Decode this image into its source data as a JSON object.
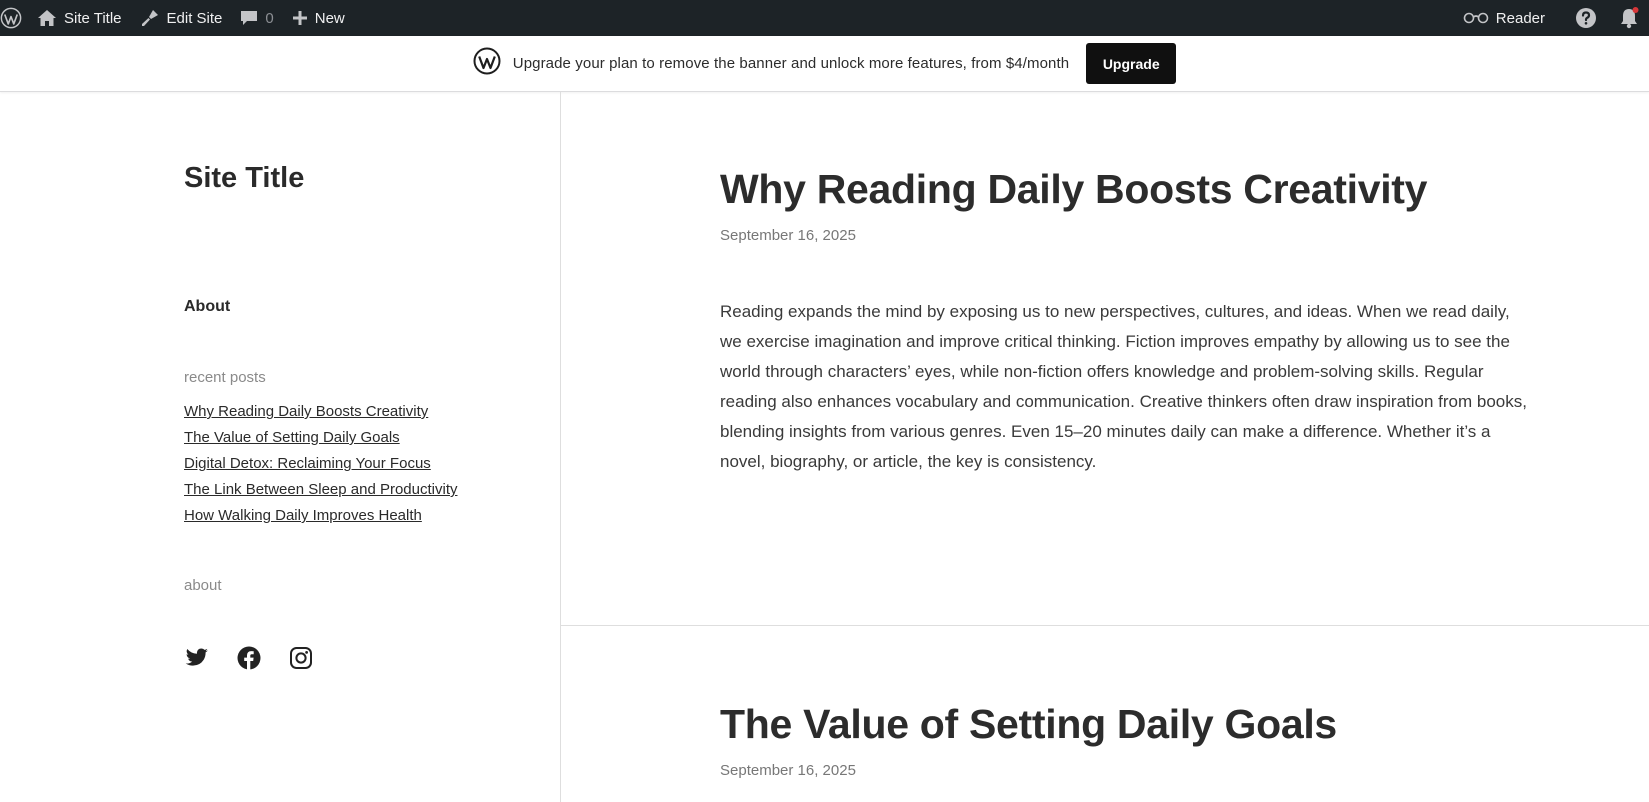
{
  "admin_bar": {
    "site_title": "Site Title",
    "edit_site": "Edit Site",
    "comments_count": "0",
    "new_label": "New",
    "reader_label": "Reader"
  },
  "banner": {
    "text": "Upgrade your plan to remove the banner and unlock more features, from $4/month",
    "button": "Upgrade"
  },
  "sidebar": {
    "site_title": "Site Title",
    "nav_about": "About",
    "recent_posts_title": "recent posts",
    "recent_posts": [
      "Why Reading Daily Boosts Creativity",
      "The Value of Setting Daily Goals",
      "Digital Detox: Reclaiming Your Focus",
      "The Link Between Sleep and Productivity",
      "How Walking Daily Improves Health"
    ],
    "about_title": "about",
    "social_icons": [
      "twitter-icon",
      "facebook-icon",
      "instagram-icon"
    ]
  },
  "posts": [
    {
      "title": "Why Reading Daily Boosts Creativity",
      "date": "September 16, 2025",
      "excerpt": "Reading expands the mind by exposing us to new perspectives, cultures, and ideas. When we read daily, we exercise imagination and improve critical thinking. Fiction improves empathy by allowing us to see the world through characters’ eyes, while non-fiction offers knowledge and problem-solving skills. Regular reading also enhances vocabulary and communication. Creative thinkers often draw inspiration from books, blending insights from various genres. Even 15–20 minutes daily can make a difference. Whether it’s a novel, biography, or article, the key is consistency."
    },
    {
      "title": "The Value of Setting Daily Goals",
      "date": "September 16, 2025"
    }
  ],
  "colors": {
    "admin_bar_bg": "#1d2327",
    "notification_dot": "#d63638",
    "button_bg": "#101010"
  }
}
